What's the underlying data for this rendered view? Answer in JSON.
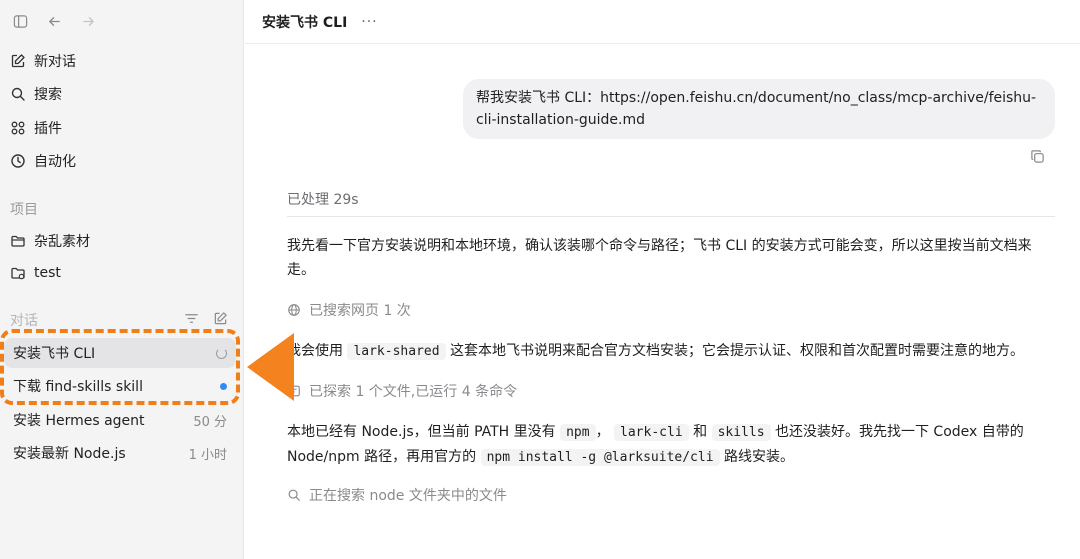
{
  "sidebar": {
    "nav": [
      {
        "label": "新对话",
        "icon": "compose-icon"
      },
      {
        "label": "搜索",
        "icon": "search-icon"
      },
      {
        "label": "插件",
        "icon": "plugins-icon"
      },
      {
        "label": "自动化",
        "icon": "clock-icon"
      }
    ],
    "projects_label": "项目",
    "projects": [
      {
        "label": "杂乱素材",
        "icon": "folder-icon"
      },
      {
        "label": "test",
        "icon": "folder-icon"
      }
    ],
    "conversations_label": "对话",
    "conversations": [
      {
        "title": "安装飞书 CLI",
        "status": "loading"
      },
      {
        "title": "下载 find-skills skill",
        "status": "unread"
      },
      {
        "title": "安装 Hermes agent",
        "time": "50 分"
      },
      {
        "title": "安装最新 Node.js",
        "time": "1 小时"
      }
    ]
  },
  "header": {
    "title": "安装飞书 CLI",
    "more": "···"
  },
  "chat": {
    "user_message": "帮我安装飞书 CLI：https://open.feishu.cn/document/no_class/mcp-archive/feishu-cli-installation-guide.md",
    "processed": "已处理 29s",
    "para1": "我先看一下官方安装说明和本地环境，确认该装哪个命令与路径；飞书 CLI 的安装方式可能会变，所以这里按当前文档来走。",
    "meta1": "已搜索网页 1 次",
    "para2_pre": "我会使用",
    "para2_code": "lark-shared",
    "para2_post": "这套本地飞书说明来配合官方文档安装；它会提示认证、权限和首次配置时需要注意的地方。",
    "meta2": "已探索 1 个文件,已运行 4 条命令",
    "para3_a": "本地已经有 Node.js，但当前 PATH 里没有",
    "para3_code1": "npm",
    "para3_b": "，",
    "para3_code2": "lark-cli",
    "para3_c": "和",
    "para3_code3": "skills",
    "para3_d": "也还没装好。我先找一下 Codex 自带的 Node/npm 路径，再用官方的",
    "para3_code4": "npm install -g @larksuite/cli",
    "para3_e": "路线安装。",
    "meta3": "正在搜索 node 文件夹中的文件"
  },
  "colors": {
    "accent_orange": "#f07f1a",
    "unread_dot": "#2f8cf4"
  }
}
